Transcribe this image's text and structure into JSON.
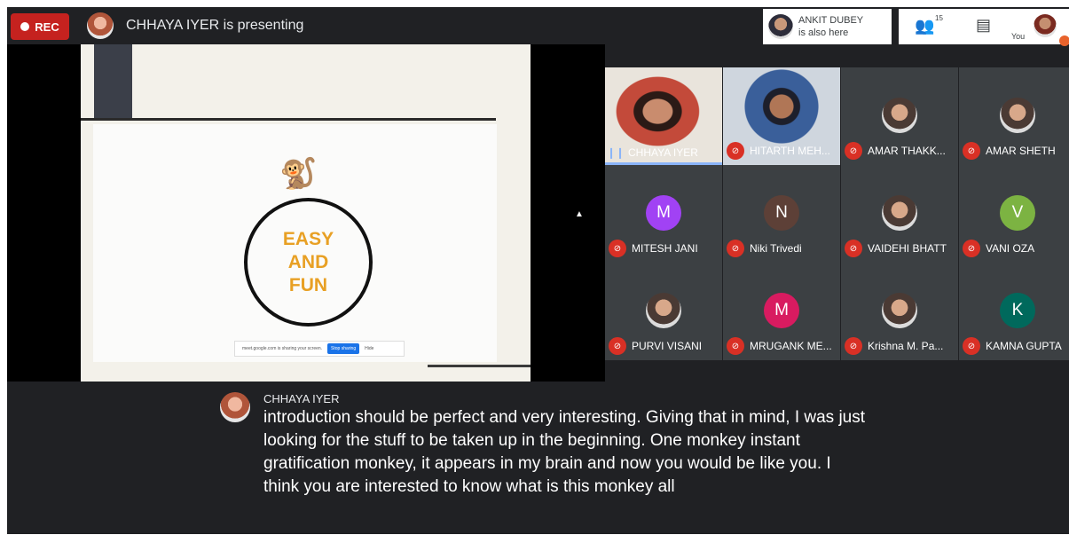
{
  "topbar": {
    "rec_label": "REC",
    "presenting_text": "CHHAYA IYER is presenting",
    "also_here": {
      "name": "ANKIT DUBEY",
      "status": "is also here"
    },
    "people_count": "15",
    "you_label": "You"
  },
  "screen_share": {
    "slide_text": [
      "EASY",
      "AND",
      "FUN"
    ],
    "share_notice": "meet.google.com is sharing your screen.",
    "stop_sharing_label": "Stop sharing",
    "hide_label": "Hide"
  },
  "participants": [
    {
      "name": "CHHAYA IYER",
      "speaking": true
    },
    {
      "name": "HITARTH MEH...",
      "muted": true
    },
    {
      "name": "AMAR THAKK...",
      "muted": true
    },
    {
      "name": "AMAR SHETH",
      "muted": true
    },
    {
      "name": "MITESH JANI",
      "initial": "M",
      "color": "#a142f4",
      "muted": true
    },
    {
      "name": "Niki Trivedi",
      "initial": "N",
      "color": "#5d4037",
      "muted": true
    },
    {
      "name": "VAIDEHI BHATT",
      "muted": true
    },
    {
      "name": "VANI OZA",
      "initial": "V",
      "color": "#7cb342",
      "muted": true
    },
    {
      "name": "PURVI VISANI",
      "muted": true
    },
    {
      "name": "MRUGANK ME...",
      "initial": "M",
      "color": "#d81b60",
      "muted": true
    },
    {
      "name": "Krishna M. Pa...",
      "muted": true
    },
    {
      "name": "KAMNA GUPTA",
      "initial": "K",
      "color": "#00695c",
      "muted": true
    }
  ],
  "caption": {
    "speaker": "CHHAYA IYER",
    "text": "introduction should be perfect and very interesting. Giving that in mind, I was just looking for the stuff to be taken up in the beginning. One monkey instant gratification monkey, it appears in my brain and now you would be like you. I think you are interested to know what is this monkey all"
  },
  "colors": {
    "rec": "#c5221f",
    "mic_off": "#d93025",
    "accent": "#8ab4f8",
    "slide_text": "#e8a024"
  }
}
